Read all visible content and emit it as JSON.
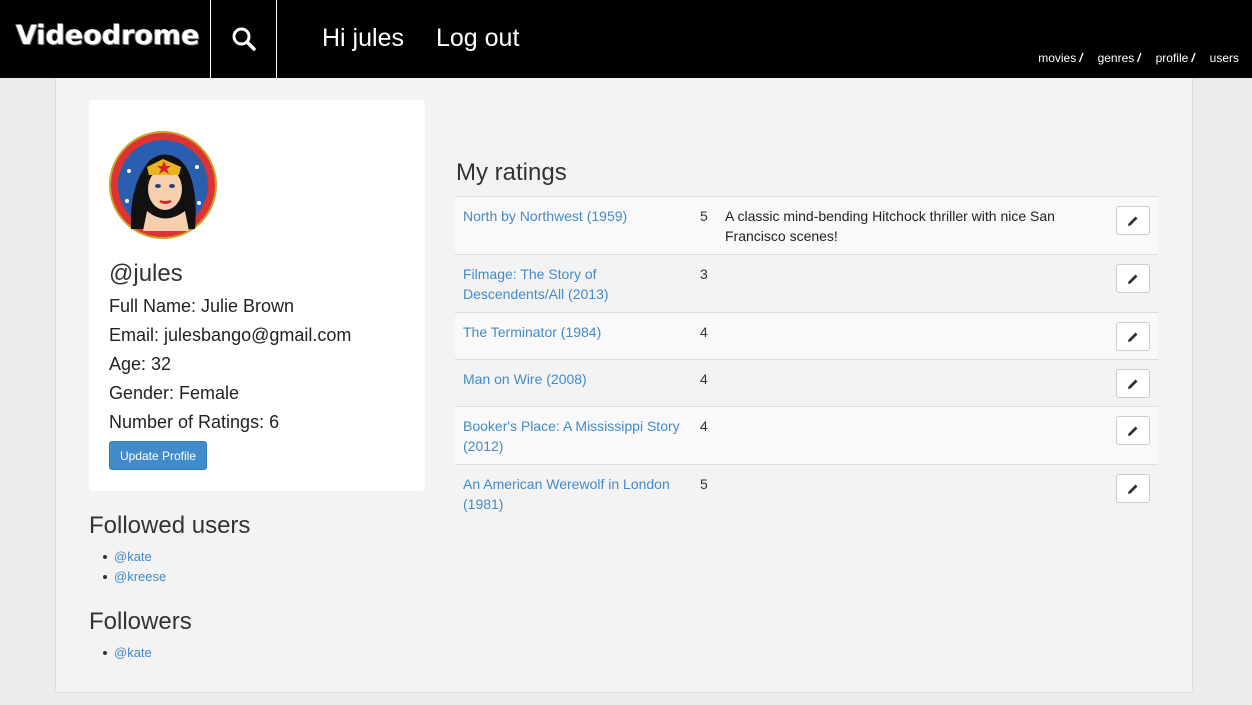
{
  "navbar": {
    "brand": "Videodrome",
    "greeting": "Hi jules",
    "logout": "Log out",
    "crumbs": [
      {
        "label": "movies",
        "sep": "/"
      },
      {
        "label": "genres",
        "sep": "/"
      },
      {
        "label": "profile",
        "sep": "/"
      },
      {
        "label": "users",
        "sep": ""
      }
    ],
    "search_icon": "search-icon"
  },
  "profile": {
    "handle": "@jules",
    "full_name": "Full Name: Julie Brown",
    "email": "Email: julesbango@gmail.com",
    "age": "Age: 32",
    "gender": "Gender: Female",
    "ratings_count": "Number of Ratings: 6",
    "update_label": "Update Profile"
  },
  "followed": {
    "title": "Followed users",
    "users": [
      "@kate",
      "@kreese"
    ]
  },
  "followers": {
    "title": "Followers",
    "users": [
      "@kate"
    ]
  },
  "ratings": {
    "title": "My ratings",
    "rows": [
      {
        "title": "North by Northwest (1959)",
        "score": "5",
        "comment": "A classic mind-bending Hitchock thriller with nice San Francisco scenes!"
      },
      {
        "title": "Filmage: The Story of Descendents/All (2013)",
        "score": "3",
        "comment": ""
      },
      {
        "title": "The Terminator (1984)",
        "score": "4",
        "comment": ""
      },
      {
        "title": "Man on Wire (2008)",
        "score": "4",
        "comment": ""
      },
      {
        "title": "Booker's Place: A Mississippi Story (2012)",
        "score": "4",
        "comment": ""
      },
      {
        "title": "An American Werewolf in London (1981)",
        "score": "5",
        "comment": ""
      }
    ]
  },
  "colors": {
    "navbar_bg": "#000000",
    "link": "#428bca",
    "primary_button": "#428bca",
    "page_bg": "#ececec"
  }
}
